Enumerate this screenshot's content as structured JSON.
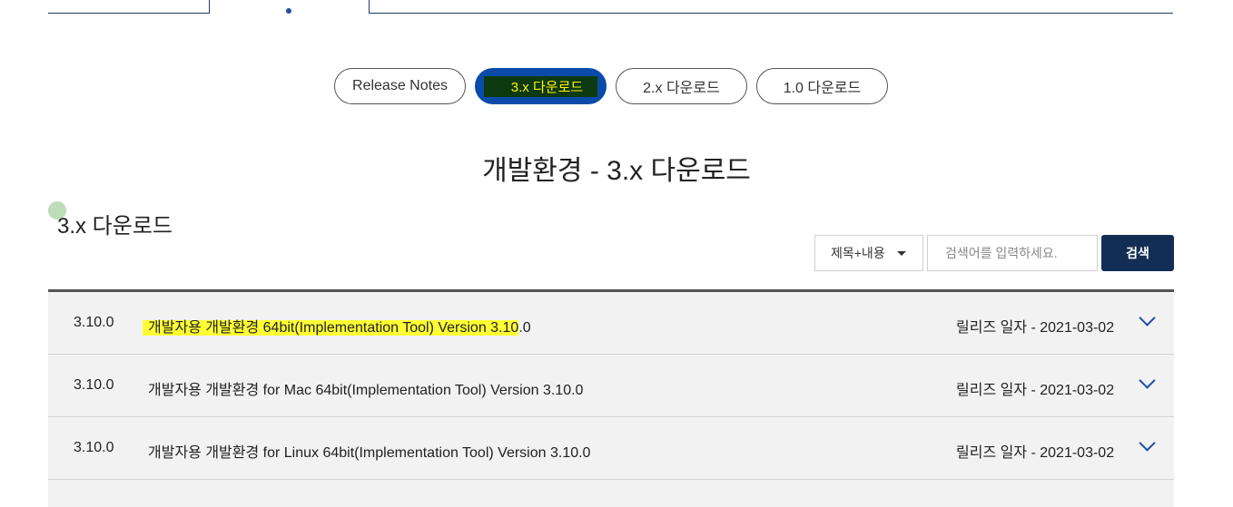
{
  "tabs": [
    {
      "label": "Release Notes",
      "active": false
    },
    {
      "label": "3.x 다운로드",
      "active": true
    },
    {
      "label": "2.x 다운로드",
      "active": false
    },
    {
      "label": "1.0 다운로드",
      "active": false
    }
  ],
  "page_title": "개발환경 - 3.x 다운로드",
  "section_title": "3.x 다운로드",
  "search": {
    "select_value": "제목+내용",
    "placeholder": "검색어를 입력하세요.",
    "button_label": "검색"
  },
  "rows": [
    {
      "version": "3.10.0",
      "title_highlighted": "개발자용 개발환경 64bit(Implementation Tool) Version 3.10",
      "title_rest": ".0",
      "date": "릴리즈 일자 - 2021-03-02"
    },
    {
      "version": "3.10.0",
      "title": "개발자용 개발환경 for Mac 64bit(Implementation Tool) Version 3.10.0",
      "date": "릴리즈 일자 - 2021-03-02"
    },
    {
      "version": "3.10.0",
      "title": "개발자용 개발환경 for Linux 64bit(Implementation Tool) Version 3.10.0",
      "date": "릴리즈 일자 - 2021-03-02"
    }
  ],
  "colors": {
    "accent": "#0a4aa8",
    "search_button": "#132e55",
    "highlight": "#ffff33"
  }
}
